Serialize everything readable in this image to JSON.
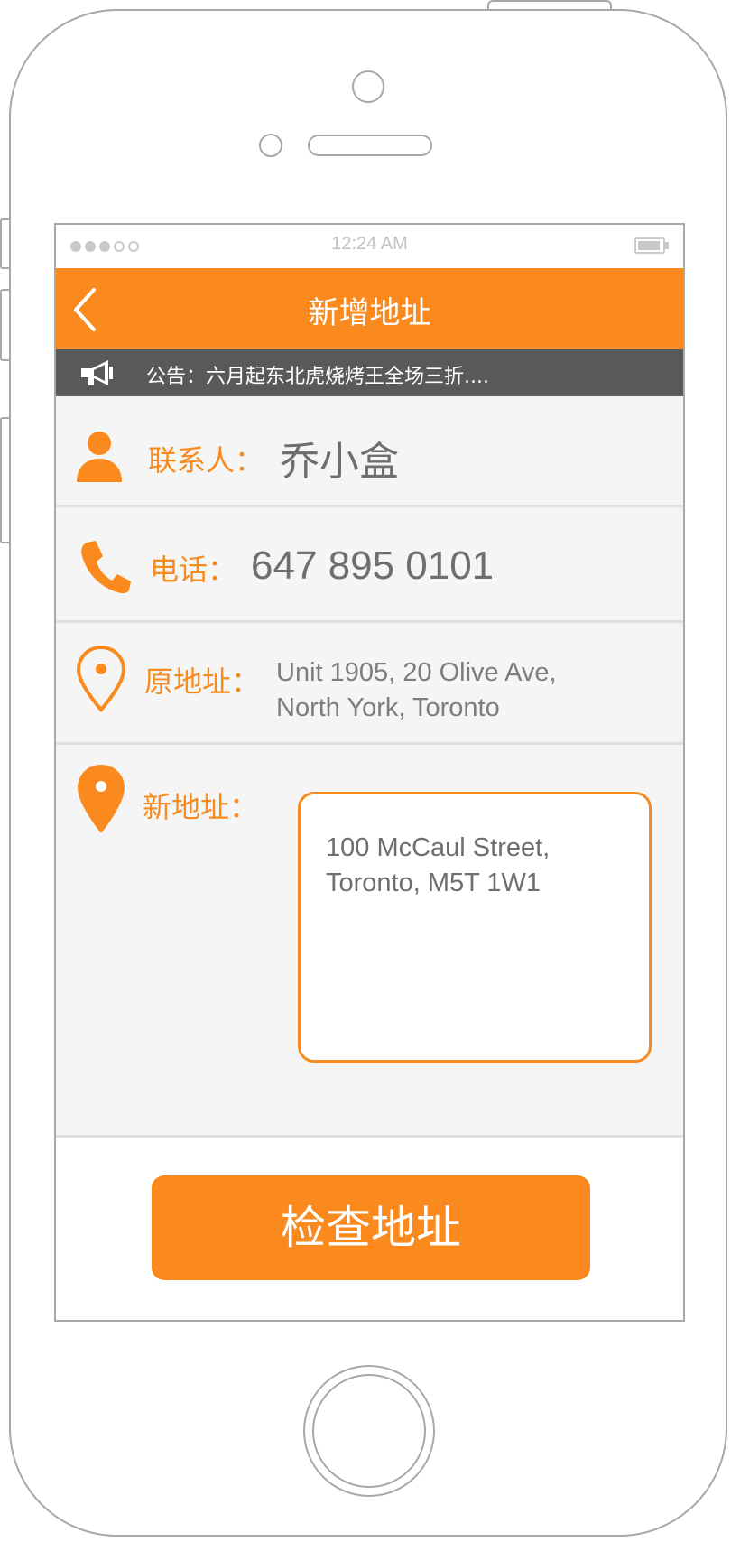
{
  "status_bar": {
    "time": "12:24 AM",
    "signal_icon": "signal-dots-icon",
    "battery_icon": "battery-icon"
  },
  "nav": {
    "title": "新增地址",
    "back_icon": "chevron-left-icon"
  },
  "notice": {
    "icon": "megaphone-icon",
    "text": "公告：六月起东北虎烧烤王全场三折...."
  },
  "form": {
    "contact": {
      "icon": "person-icon",
      "label": "联系人：",
      "value": "乔小盒"
    },
    "phone": {
      "icon": "phone-icon",
      "label": "电话：",
      "value": "647 895 0101"
    },
    "original_address": {
      "icon": "location-pin-outline-icon",
      "label": "原地址：",
      "line1": "Unit 1905, 20 Olive Ave,",
      "line2": "North York, Toronto"
    },
    "new_address": {
      "icon": "location-pin-filled-icon",
      "label": "新地址：",
      "value": "100 McCaul Street,\nToronto, M5T 1W1"
    }
  },
  "actions": {
    "check_address_label": "检查地址"
  },
  "colors": {
    "accent": "#fa8a1e",
    "notice_bg": "#58595b",
    "form_bg": "#f4f5f4",
    "label": "#f68b1f",
    "value": "#6d6e70"
  }
}
